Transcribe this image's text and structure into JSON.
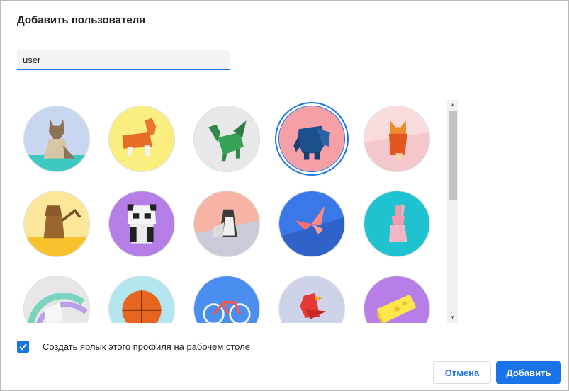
{
  "dialog": {
    "title": "Добавить пользователя",
    "name_value": "user"
  },
  "avatars": [
    {
      "name": "cat",
      "bg": "#c8d7ef",
      "selected": false
    },
    {
      "name": "corgi",
      "bg": "#f9ee7e",
      "selected": false
    },
    {
      "name": "dragon",
      "bg": "#e8e8e8",
      "selected": false
    },
    {
      "name": "elephant",
      "bg": "#f5a0a6",
      "selected": true
    },
    {
      "name": "fox",
      "bg": "#fadcdf",
      "selected": false
    },
    {
      "name": "monkey",
      "bg": "#fbe79a",
      "selected": false
    },
    {
      "name": "panda",
      "bg": "#b47ee6",
      "selected": false
    },
    {
      "name": "penguin",
      "bg": "#f7b3a3",
      "selected": false
    },
    {
      "name": "butterfly",
      "bg": "#3b78e7",
      "selected": false
    },
    {
      "name": "rabbit",
      "bg": "#1fc3d0",
      "selected": false
    },
    {
      "name": "unicorn",
      "bg": "#e7e7e7",
      "selected": false
    },
    {
      "name": "basketball",
      "bg": "#b3e5ef",
      "selected": false
    },
    {
      "name": "bicycle",
      "bg": "#4a8ef0",
      "selected": false
    },
    {
      "name": "bird",
      "bg": "#cfd3ea",
      "selected": false
    },
    {
      "name": "cheese",
      "bg": "#b77ee8",
      "selected": false
    }
  ],
  "shortcut": {
    "checked": true,
    "label": "Создать ярлык этого профиля на рабочем столе"
  },
  "buttons": {
    "cancel": "Отмена",
    "add": "Добавить"
  },
  "colors": {
    "accent": "#1a73e8"
  }
}
